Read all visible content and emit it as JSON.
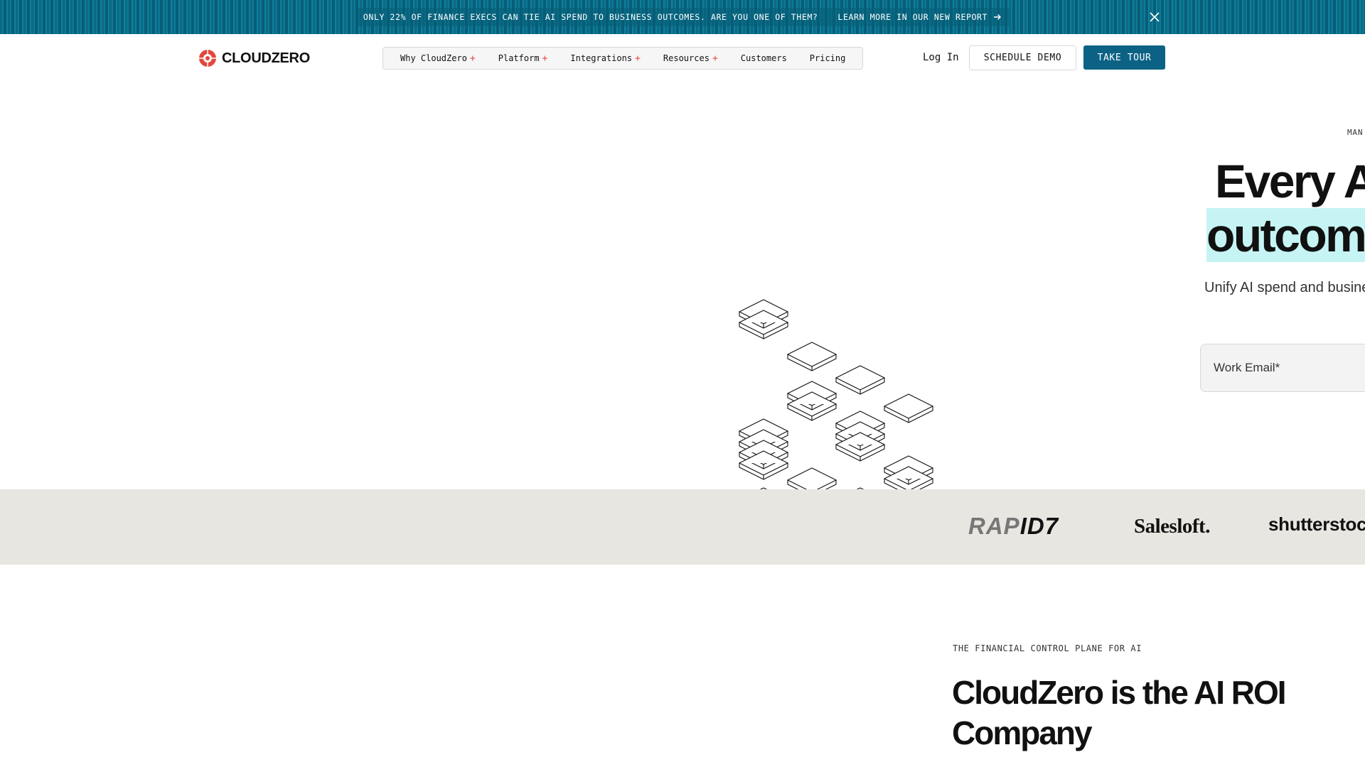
{
  "banner": {
    "message": "ONLY 22% OF FINANCE EXECS CAN TIE AI SPEND TO BUSINESS OUTCOMES. ARE YOU ONE OF THEM?",
    "link_label": "LEARN MORE IN OUR NEW REPORT",
    "close_icon": "close-icon",
    "color": "#0a6a86"
  },
  "nav": {
    "brand": "CLOUDZERO",
    "menu": [
      {
        "label": "Why CloudZero",
        "expandable": true
      },
      {
        "label": "Platform",
        "expandable": true
      },
      {
        "label": "Integrations",
        "expandable": true
      },
      {
        "label": "Resources",
        "expandable": true
      },
      {
        "label": "Customers",
        "expandable": false
      },
      {
        "label": "Pricing",
        "expandable": false
      }
    ],
    "plus_glyph": "+",
    "login_label": "Log In",
    "schedule_demo_label": "SCHEDULE DEMO",
    "take_tour_label": "TAKE TOUR",
    "accent_color": "#0b6285",
    "plus_color": "#e2483d"
  },
  "hero": {
    "eyebrow": "MAN",
    "headline_line1": "Every A",
    "headline_line2": "outcome",
    "subtitle": "Unify AI spend and busine",
    "email_placeholder": "Work Email*",
    "highlight_color": "#c6f4f4"
  },
  "logos": {
    "rapid_a": "RAP",
    "rapid_b": "ID7",
    "salesloft": "Salesloft.",
    "shutterstock": "shutterstoc",
    "strip_color": "#e8e6e1"
  },
  "section": {
    "eyebrow": "THE FINANCIAL CONTROL PLANE FOR AI",
    "title": "CloudZero is the AI ROI Company"
  }
}
